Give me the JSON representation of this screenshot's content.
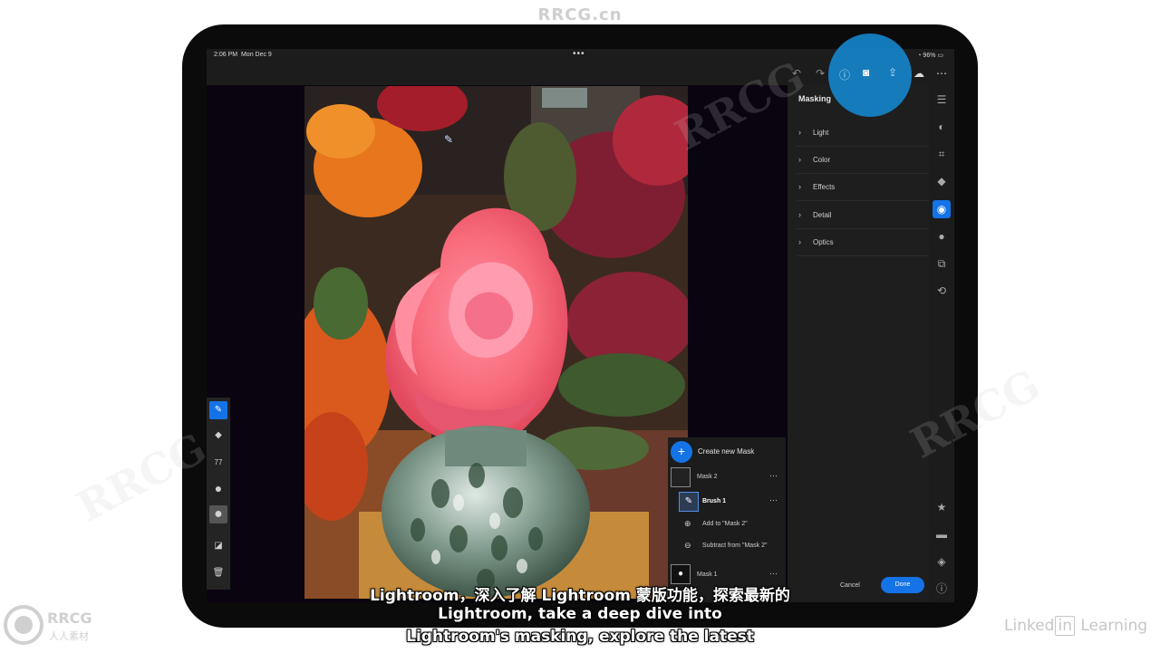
{
  "watermark": {
    "site": "RRCG.cn",
    "brand": "RRCG",
    "brand_sub": "人人素材"
  },
  "status_bar": {
    "time": "2:06 PM",
    "date": "Mon Dec 9",
    "battery": "96%"
  },
  "toolbar": {
    "icons": [
      "undo-icon",
      "redo-icon",
      "help-icon",
      "camera-icon",
      "share-icon",
      "cloud-sync-icon",
      "more-icon"
    ]
  },
  "panel": {
    "title": "Masking",
    "sections": [
      "Light",
      "Color",
      "Effects",
      "Detail",
      "Optics"
    ]
  },
  "masks": {
    "create_label": "Create new Mask",
    "mask2": "Mask 2",
    "brush1": "Brush 1",
    "add_to": "Add to \"Mask 2\"",
    "subtract_from": "Subtract from \"Mask 2\"",
    "mask1": "Mask 1"
  },
  "left_tools": {
    "size_value": "77"
  },
  "footer": {
    "cancel": "Cancel",
    "done": "Done"
  },
  "subtitles": {
    "line1": "Lightroom，深入了解 Lightroom 蒙版功能，探索最新的",
    "line2": "Lightroom, take a deep dive into",
    "line3": "Lightroom's masking, explore the latest"
  },
  "linkedin": {
    "part1": "Linked",
    "part2": "in",
    "part3": " Learning"
  },
  "colors": {
    "accent": "#1473e6",
    "highlight": "#1583c9"
  }
}
